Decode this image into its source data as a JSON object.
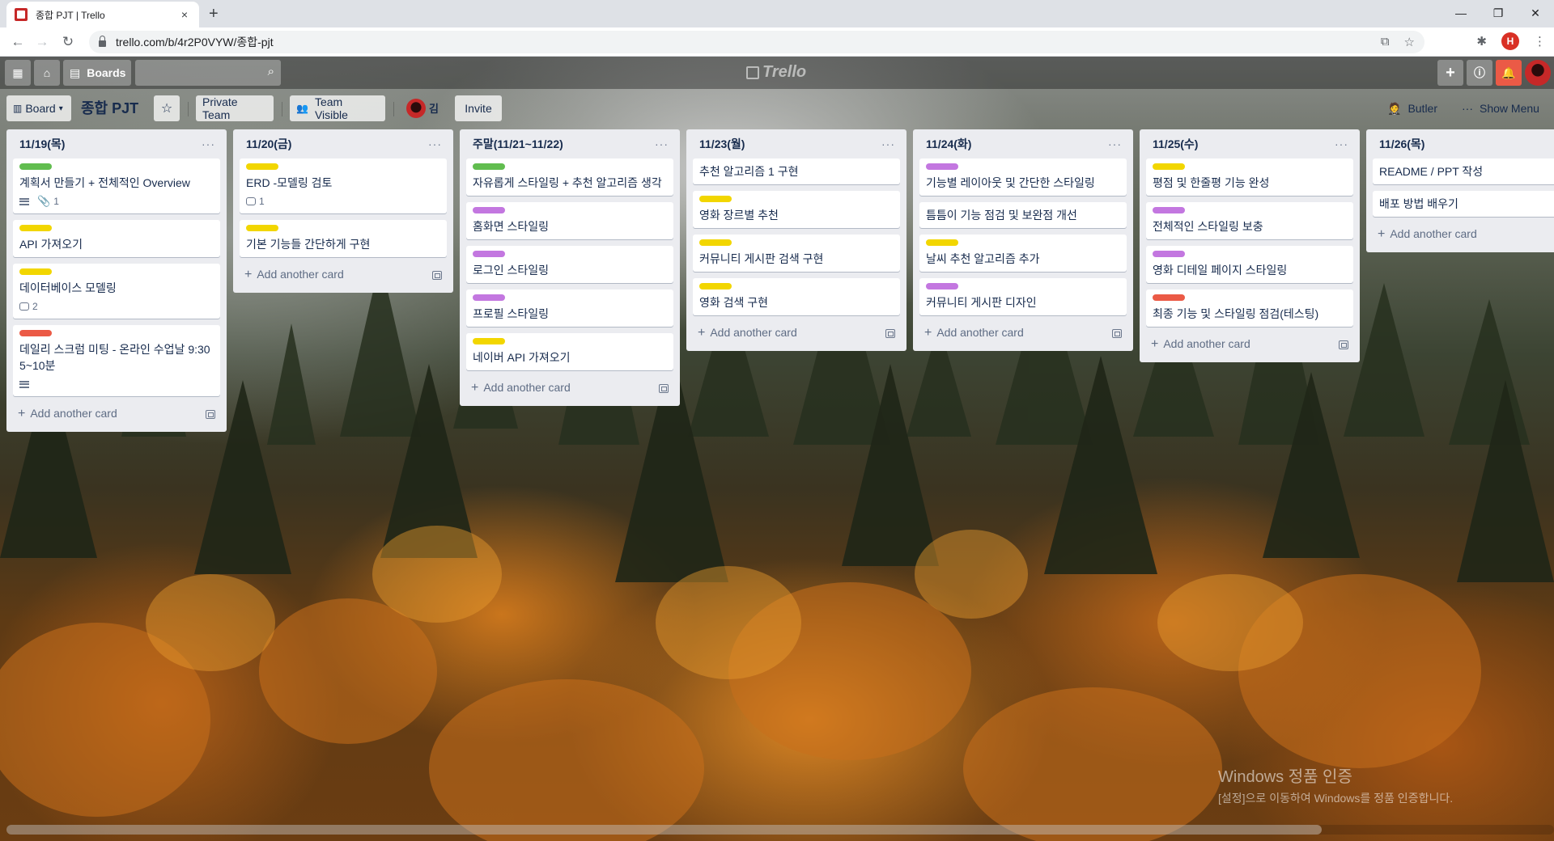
{
  "browser": {
    "tab_title": "종합 PJT | Trello",
    "tab_close": "×",
    "new_tab": "+",
    "url": "trello.com/b/4r2P0VYW/종합-pjt",
    "profile_initial": "H",
    "window_controls": [
      "—",
      "❐",
      "✕"
    ]
  },
  "trello_header": {
    "boards_label": "Boards",
    "logo_text": "Trello"
  },
  "board_header": {
    "board_switch": "Board",
    "title": "종합 PJT",
    "star": "☆",
    "private_team": "Private Team",
    "team_visible": "Team Visible",
    "member_initial": "김",
    "invite": "Invite",
    "butler": "Butler",
    "show_menu": "Show Menu"
  },
  "add_card_label": "Add another card",
  "lists": [
    {
      "title": "11/19(목)",
      "cards": [
        {
          "label": "green",
          "title": "계획서 만들기 + 전체적인 Overview",
          "desc": true,
          "attach": "1"
        },
        {
          "label": "yellow",
          "title": "API 가져오기"
        },
        {
          "label": "yellow",
          "title": "데이터베이스 모델링",
          "comments": "2"
        },
        {
          "label": "red",
          "title": "데일리 스크럼 미팅 - 온라인 수업날 9:30 5~10분",
          "desc": true
        }
      ]
    },
    {
      "title": "11/20(금)",
      "cards": [
        {
          "label": "yellow",
          "title": "ERD -모델링 검토",
          "comments": "1"
        },
        {
          "label": "yellow",
          "title": "기본 기능들 간단하게 구현"
        }
      ]
    },
    {
      "title": "주말(11/21~11/22)",
      "cards": [
        {
          "label": "green",
          "title": "자유롭게 스타일링 + 추천 알고리즘 생각"
        },
        {
          "label": "purple",
          "title": "홈화면 스타일링"
        },
        {
          "label": "purple",
          "title": "로그인 스타일링"
        },
        {
          "label": "purple",
          "title": "프로필 스타일링"
        },
        {
          "label": "yellow",
          "title": "네이버 API 가져오기"
        }
      ]
    },
    {
      "title": "11/23(월)",
      "cards": [
        {
          "label": "",
          "title": "추천 알고리즘 1 구현"
        },
        {
          "label": "yellow",
          "title": "영화 장르별 추천"
        },
        {
          "label": "yellow",
          "title": "커뮤니티 게시판 검색 구현"
        },
        {
          "label": "yellow",
          "title": "영화 검색 구현"
        }
      ]
    },
    {
      "title": "11/24(화)",
      "cards": [
        {
          "label": "purple",
          "title": "기능별 레이아웃 및 간단한 스타일링"
        },
        {
          "label": "",
          "title": "틈틈이 기능 점검 및 보완점 개선"
        },
        {
          "label": "yellow",
          "title": "날씨 추천 알고리즘 추가"
        },
        {
          "label": "purple",
          "title": "커뮤니티 게시판 디자인"
        }
      ]
    },
    {
      "title": "11/25(수)",
      "cards": [
        {
          "label": "yellow",
          "title": "평점 및 한줄평 기능 완성"
        },
        {
          "label": "purple",
          "title": "전체적인 스타일링 보충"
        },
        {
          "label": "purple",
          "title": "영화 디테일 페이지 스타일링"
        },
        {
          "label": "red",
          "title": "최종 기능 및 스타일링 점검(테스팅)"
        }
      ]
    },
    {
      "title": "11/26(목)",
      "cards": [
        {
          "label": "",
          "title": "README / PPT 작성"
        },
        {
          "label": "",
          "title": "배포 방법 배우기"
        }
      ]
    }
  ],
  "watermark": {
    "line1": "Windows 정품 인증",
    "line2": "[설정]으로 이동하여 Windows를 정품 인증합니다."
  }
}
